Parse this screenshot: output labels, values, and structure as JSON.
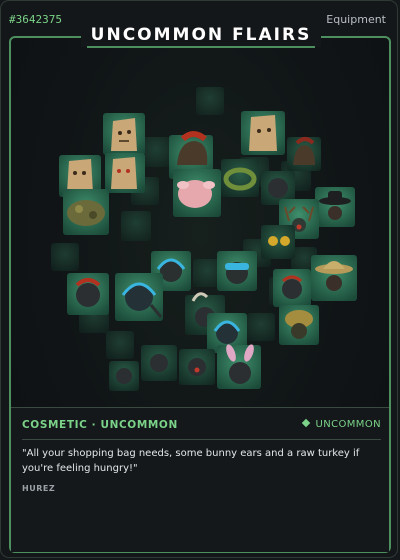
{
  "card": {
    "serial": "#3642375",
    "category": "Equipment",
    "title": "UNCOMMON FLAIRS",
    "accent_color": "#7bd389",
    "frame_color": "#4e8f5f"
  },
  "artwork": {
    "items": [
      "bunny-ears-icon",
      "paper-bag-mask-icon",
      "paper-bag-mask-icon",
      "paper-bag-mask-icon",
      "paper-bag-mask-icon",
      "roman-helmet-icon",
      "raw-turkey-icon",
      "camo-helmet-icon",
      "wreath-icon",
      "safari-hat-icon",
      "goggles-icon",
      "headphones-icon",
      "antlers-icon",
      "tribal-mask-icon",
      "turban-icon",
      "hood-icon",
      "horn-helmet-icon",
      "cowboy-hat-icon"
    ]
  },
  "info": {
    "tagline": "COSMETIC · UNCOMMON",
    "rarity_label": "UNCOMMON",
    "quote": "\"All your shopping bag needs, some bunny ears and a raw turkey if you're feeling hungry!\"",
    "author": "HUREZ"
  }
}
